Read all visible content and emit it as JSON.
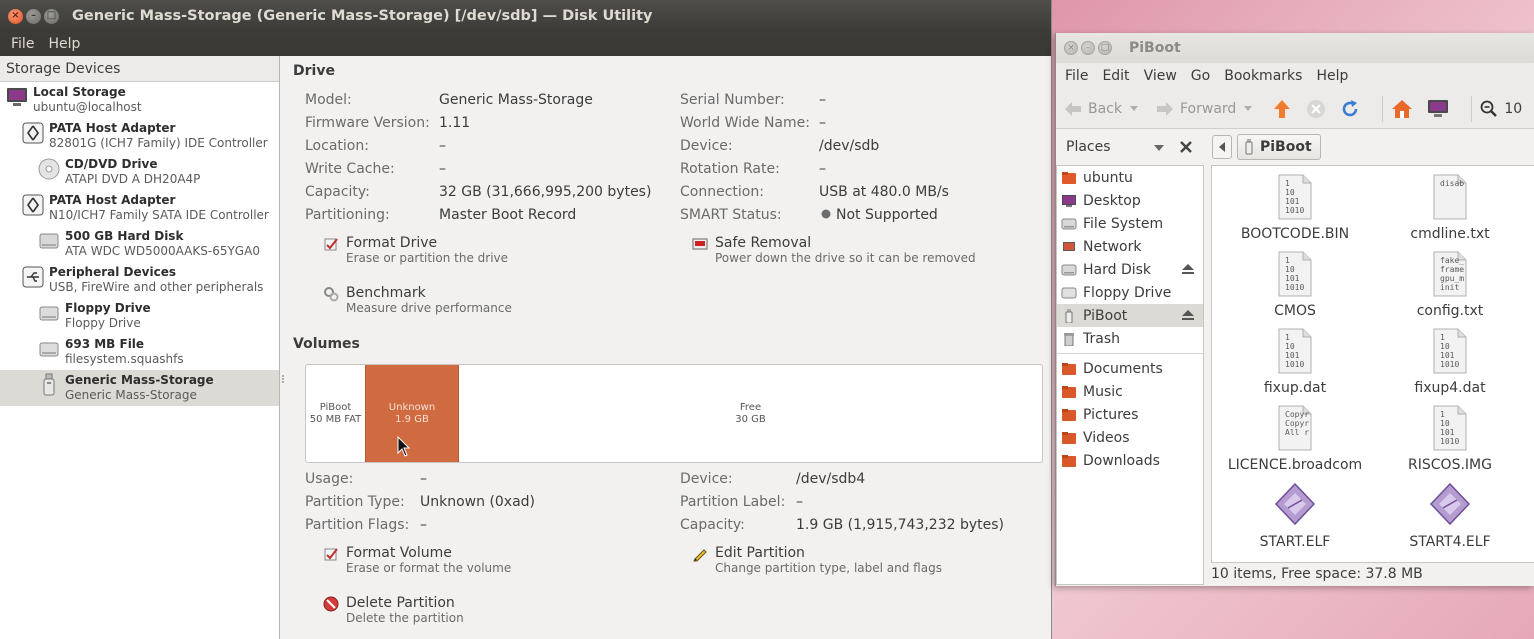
{
  "disk_utility": {
    "title": "Generic Mass-Storage (Generic Mass-Storage) [/dev/sdb] — Disk Utility",
    "menu": [
      "File",
      "Help"
    ],
    "sidebar": {
      "header": "Storage Devices",
      "items": [
        {
          "name": "Local Storage",
          "sub": "ubuntu@localhost"
        },
        {
          "name": "PATA Host Adapter",
          "sub": "82801G (ICH7 Family) IDE Controller"
        },
        {
          "name": "CD/DVD Drive",
          "sub": "ATAPI DVD A  DH20A4P"
        },
        {
          "name": "PATA Host Adapter",
          "sub": "N10/ICH7 Family SATA IDE Controller"
        },
        {
          "name": "500 GB Hard Disk",
          "sub": "ATA WDC WD5000AAKS-65YGA0"
        },
        {
          "name": "Peripheral Devices",
          "sub": "USB, FireWire and other peripherals"
        },
        {
          "name": "Floppy Drive",
          "sub": "Floppy Drive"
        },
        {
          "name": "693 MB File",
          "sub": "filesystem.squashfs"
        },
        {
          "name": "Generic Mass-Storage",
          "sub": "Generic Mass-Storage"
        }
      ]
    },
    "drive": {
      "title": "Drive",
      "left": [
        {
          "k": "Model:",
          "v": "Generic Mass-Storage"
        },
        {
          "k": "Firmware Version:",
          "v": "1.11"
        },
        {
          "k": "Location:",
          "v": "–"
        },
        {
          "k": "Write Cache:",
          "v": "–"
        },
        {
          "k": "Capacity:",
          "v": "32 GB (31,666,995,200 bytes)"
        },
        {
          "k": "Partitioning:",
          "v": "Master Boot Record"
        }
      ],
      "right": [
        {
          "k": "Serial Number:",
          "v": "–"
        },
        {
          "k": "World Wide Name:",
          "v": "–"
        },
        {
          "k": "Device:",
          "v": "/dev/sdb"
        },
        {
          "k": "Rotation Rate:",
          "v": "–"
        },
        {
          "k": "Connection:",
          "v": "USB at 480.0 MB/s"
        },
        {
          "k": "SMART Status:",
          "v": "Not Supported"
        }
      ],
      "actions": {
        "format": {
          "label": "Format Drive",
          "desc": "Erase or partition the drive"
        },
        "safe_removal": {
          "label": "Safe Removal",
          "desc": "Power down the drive so it can be removed"
        },
        "benchmark": {
          "label": "Benchmark",
          "desc": "Measure drive performance"
        }
      }
    },
    "volumes": {
      "title": "Volumes",
      "segments": [
        {
          "name": "PiBoot",
          "size": "50 MB FAT"
        },
        {
          "name": "Unknown",
          "size": "1.9 GB"
        },
        {
          "name": "Free",
          "size": "30 GB"
        }
      ],
      "left": [
        {
          "k": "Usage:",
          "v": "–"
        },
        {
          "k": "Partition Type:",
          "v": "Unknown (0xad)"
        },
        {
          "k": "Partition Flags:",
          "v": "–"
        }
      ],
      "right": [
        {
          "k": "Device:",
          "v": "/dev/sdb4"
        },
        {
          "k": "Partition Label:",
          "v": "–"
        },
        {
          "k": "Capacity:",
          "v": "1.9 GB (1,915,743,232 bytes)"
        }
      ],
      "actions": {
        "format": {
          "label": "Format Volume",
          "desc": "Erase or format the volume"
        },
        "edit": {
          "label": "Edit Partition",
          "desc": "Change partition type, label and flags"
        },
        "delete": {
          "label": "Delete Partition",
          "desc": "Delete the partition"
        }
      }
    }
  },
  "file_manager": {
    "title": "PiBoot",
    "menu": [
      "File",
      "Edit",
      "View",
      "Go",
      "Bookmarks",
      "Help"
    ],
    "toolbar": {
      "back": "Back",
      "forward": "Forward",
      "zoom": "10"
    },
    "places_label": "Places",
    "places": [
      {
        "label": "ubuntu",
        "icon": "home-folder-icon"
      },
      {
        "label": "Desktop",
        "icon": "desktop-icon"
      },
      {
        "label": "File System",
        "icon": "filesystem-icon"
      },
      {
        "label": "Network",
        "icon": "network-icon"
      },
      {
        "label": "Hard Disk",
        "icon": "harddisk-icon"
      },
      {
        "label": "Floppy Drive",
        "icon": "floppy-icon"
      },
      {
        "label": "PiBoot",
        "icon": "usb-drive-icon"
      },
      {
        "label": "Trash",
        "icon": "trash-icon"
      },
      {
        "label": "Documents",
        "icon": "folder-icon"
      },
      {
        "label": "Music",
        "icon": "folder-icon"
      },
      {
        "label": "Pictures",
        "icon": "folder-icon"
      },
      {
        "label": "Videos",
        "icon": "folder-icon"
      },
      {
        "label": "Downloads",
        "icon": "folder-icon"
      }
    ],
    "path": "PiBoot",
    "files": [
      {
        "name": "BOOTCODE.BIN",
        "preview": "1\n10\n101\n1010"
      },
      {
        "name": "cmdline.txt",
        "preview": "disab"
      },
      {
        "name": "CMOS",
        "preview": "1\n10\n101\n1010"
      },
      {
        "name": "config.txt",
        "preview": "fake_\nframe\ngpu_m\ninit"
      },
      {
        "name": "fixup.dat",
        "preview": "1\n10\n101\n1010"
      },
      {
        "name": "fixup4.dat",
        "preview": "1\n10\n101\n1010"
      },
      {
        "name": "LICENCE.broadcom",
        "preview": "Copyr\nCopyr\nAll r"
      },
      {
        "name": "RISCOS.IMG",
        "preview": "1\n10\n101\n1010"
      },
      {
        "name": "START.ELF",
        "preview": ""
      },
      {
        "name": "START4.ELF",
        "preview": ""
      }
    ],
    "status": "10 items, Free space: 37.8 MB"
  }
}
